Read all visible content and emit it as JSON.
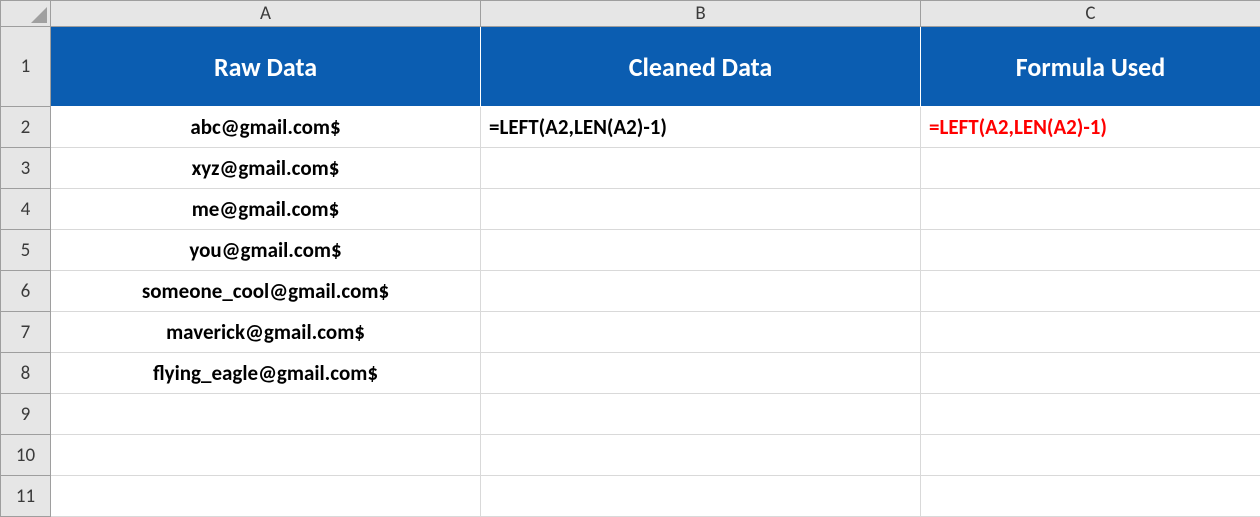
{
  "columns": {
    "A": "A",
    "B": "B",
    "C": "C"
  },
  "rows": [
    "1",
    "2",
    "3",
    "4",
    "5",
    "6",
    "7",
    "8",
    "9",
    "10",
    "11"
  ],
  "header_row": {
    "A": "Raw Data",
    "B": "Cleaned Data",
    "C": "Formula Used"
  },
  "data_rows": [
    {
      "A": "abc@gmail.com$",
      "B": "=LEFT(A2,LEN(A2)-1)",
      "C": "=LEFT(A2,LEN(A2)-1)"
    },
    {
      "A": "xyz@gmail.com$",
      "B": "",
      "C": ""
    },
    {
      "A": "me@gmail.com$",
      "B": "",
      "C": ""
    },
    {
      "A": "you@gmail.com$",
      "B": "",
      "C": ""
    },
    {
      "A": "someone_cool@gmail.com$",
      "B": "",
      "C": ""
    },
    {
      "A": "maverick@gmail.com$",
      "B": "",
      "C": ""
    },
    {
      "A": "flying_eagle@gmail.com$",
      "B": "",
      "C": ""
    },
    {
      "A": "",
      "B": "",
      "C": ""
    },
    {
      "A": "",
      "B": "",
      "C": ""
    },
    {
      "A": "",
      "B": "",
      "C": ""
    }
  ],
  "colors": {
    "header_bg": "#0b5db1",
    "header_fg": "#ffffff",
    "formula_fg": "#ff0000"
  }
}
